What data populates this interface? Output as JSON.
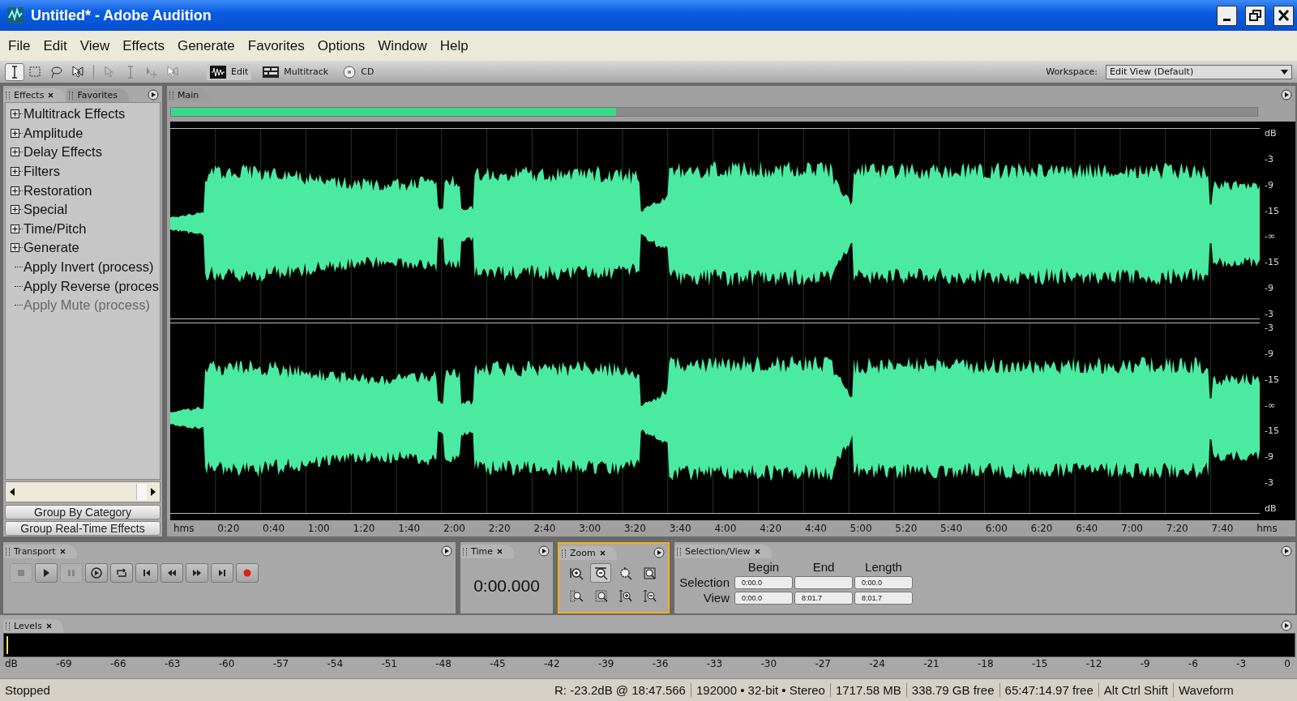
{
  "window": {
    "title": "Untitled* - Adobe Audition"
  },
  "menu": [
    "File",
    "Edit",
    "View",
    "Effects",
    "Generate",
    "Favorites",
    "Options",
    "Window",
    "Help"
  ],
  "toolbar": {
    "tools": [
      {
        "kind": "ibeam",
        "selected": true,
        "disabled": false
      },
      {
        "kind": "marquee",
        "selected": false,
        "disabled": false
      },
      {
        "kind": "lasso",
        "selected": false,
        "disabled": false
      },
      {
        "kind": "scrub",
        "selected": false,
        "disabled": false
      },
      {
        "kind": "pointer",
        "selected": false,
        "disabled": true
      },
      {
        "kind": "ibeam",
        "selected": false,
        "disabled": true
      },
      {
        "kind": "move",
        "selected": false,
        "disabled": true
      },
      {
        "kind": "scrub",
        "selected": false,
        "disabled": true
      }
    ],
    "modes": [
      {
        "kind": "edit",
        "label": "Edit",
        "selected": true
      },
      {
        "kind": "multitrack",
        "label": "Multitrack",
        "selected": false
      },
      {
        "kind": "cd",
        "label": "CD",
        "selected": false
      }
    ],
    "workspace": {
      "label": "Workspace:",
      "value": "Edit View (Default)"
    }
  },
  "effects_panel": {
    "tabs": [
      {
        "label": "Effects",
        "selected": true
      },
      {
        "label": "Favorites",
        "selected": false
      }
    ],
    "tree": [
      {
        "kind": "group",
        "label": "Multitrack Effects",
        "expanded": false,
        "disabled": false
      },
      {
        "kind": "group",
        "label": "Amplitude",
        "expanded": false,
        "disabled": false
      },
      {
        "kind": "group",
        "label": "Delay Effects",
        "expanded": false,
        "disabled": false
      },
      {
        "kind": "group",
        "label": "Filters",
        "expanded": false,
        "disabled": false
      },
      {
        "kind": "group",
        "label": "Restoration",
        "expanded": false,
        "disabled": false
      },
      {
        "kind": "group",
        "label": "Special",
        "expanded": false,
        "disabled": false
      },
      {
        "kind": "group",
        "label": "Time/Pitch",
        "expanded": false,
        "disabled": false
      },
      {
        "kind": "group",
        "label": "Generate",
        "expanded": false,
        "disabled": false
      },
      {
        "kind": "effect",
        "label": "Apply Invert (process)",
        "disabled": false
      },
      {
        "kind": "effect",
        "label": "Apply Reverse (proces",
        "disabled": false
      },
      {
        "kind": "effect",
        "label": "Apply Mute (process)",
        "disabled": true
      }
    ],
    "buttons": [
      "Group By Category",
      "Group Real-Time Effects"
    ]
  },
  "main_panel": {
    "tab": "Main",
    "overview": {
      "level": 0.41
    },
    "channels": [
      {
        "scale": [
          "dB",
          "-3",
          "-9",
          "-15",
          "-∞",
          "-15",
          "-9",
          "-3"
        ]
      },
      {
        "scale": [
          "-3",
          "-9",
          "-15",
          "-∞",
          "-15",
          "-9",
          "-3",
          "dB"
        ]
      }
    ],
    "ruler": [
      "hms",
      "0:20",
      "0:40",
      "1:00",
      "1:20",
      "1:40",
      "2:00",
      "2:20",
      "2:40",
      "3:00",
      "3:20",
      "3:40",
      "4:00",
      "4:20",
      "4:40",
      "5:00",
      "5:20",
      "5:40",
      "6:00",
      "6:20",
      "6:40",
      "7:00",
      "7:20",
      "7:40",
      "hms"
    ]
  },
  "transport": {
    "tab": "Transport",
    "buttons": [
      {
        "kind": "stop",
        "disabled": true
      },
      {
        "kind": "play",
        "disabled": false
      },
      {
        "kind": "pause",
        "disabled": true
      },
      {
        "kind": "play-to-end",
        "disabled": false
      },
      {
        "kind": "loop",
        "disabled": false
      },
      {
        "kind": "start",
        "disabled": false
      },
      {
        "kind": "rewind",
        "disabled": false
      },
      {
        "kind": "forward",
        "disabled": false
      },
      {
        "kind": "end",
        "disabled": false
      },
      {
        "kind": "record",
        "disabled": false
      }
    ]
  },
  "time": {
    "tab": "Time",
    "value": "0:00.000"
  },
  "zoom": {
    "tab": "Zoom",
    "active": true,
    "buttons": [
      {
        "kind": "zoom-in",
        "selected": false
      },
      {
        "kind": "zoom-out",
        "selected": true
      },
      {
        "kind": "zoom-full",
        "selected": false
      },
      {
        "kind": "zoom-selection",
        "selected": false
      },
      {
        "kind": "zoom-left",
        "selected": false
      },
      {
        "kind": "zoom-right",
        "selected": false
      },
      {
        "kind": "zoom-in-v",
        "selected": false
      },
      {
        "kind": "zoom-out-v",
        "selected": false
      }
    ]
  },
  "selection_view": {
    "tab": "Selection/View",
    "columns": [
      "Begin",
      "End",
      "Length"
    ],
    "rows": [
      {
        "label": "Selection",
        "begin": "0:00.0",
        "length": "0:00.0"
      },
      {
        "label": "View",
        "begin": "0:00.0",
        "end": "8:01.7",
        "length": "8:01.7"
      }
    ]
  },
  "levels": {
    "tab": "Levels",
    "scale": [
      "dB",
      "-69",
      "-66",
      "-63",
      "-60",
      "-57",
      "-54",
      "-51",
      "-48",
      "-45",
      "-42",
      "-39",
      "-36",
      "-33",
      "-30",
      "-27",
      "-24",
      "-21",
      "-18",
      "-15",
      "-12",
      "-9",
      "-6",
      "-3",
      "0"
    ]
  },
  "status_bar": [
    "Stopped",
    "R: -23.2dB @  18:47.566",
    "192000 • 32-bit • Stereo",
    "1717.58 MB",
    "338.79 GB free",
    "65:47:14.97 free",
    "Alt Ctrl Shift",
    "Waveform"
  ]
}
